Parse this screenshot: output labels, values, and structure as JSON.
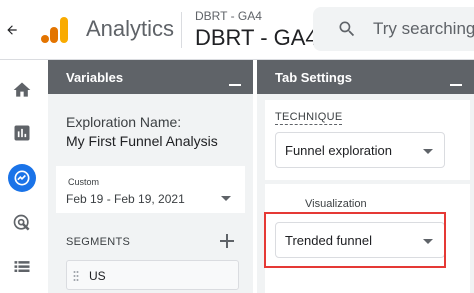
{
  "header": {
    "app_name": "Analytics",
    "account_path": "DBRT - GA4",
    "property_name": "DBRT - GA4",
    "search_placeholder": "Try searching"
  },
  "nav_rail": {
    "items": [
      "home-icon",
      "reports-icon",
      "explore-icon",
      "advertising-icon",
      "configure-icon"
    ],
    "active": "explore-icon",
    "accent_color": "#1a73e8"
  },
  "variables_panel": {
    "title": "Variables",
    "exploration_name_label": "Exploration Name:",
    "exploration_name_value": "My First Funnel Analysis",
    "date_range_tag": "Custom",
    "date_range_value": "Feb 19 - Feb 19, 2021",
    "segments_label": "SEGMENTS",
    "segment_items": [
      "US"
    ]
  },
  "tab_settings_panel": {
    "title": "Tab Settings",
    "technique_label": "TECHNIQUE",
    "technique_value": "Funnel exploration",
    "visualization_label": "Visualization",
    "visualization_value": "Trended funnel"
  },
  "colors": {
    "panel_header": "#5f6368",
    "panel_bg": "#f1f3f4",
    "highlight_border": "#e53935",
    "logo_orange": "#f9ab00",
    "logo_dark_orange": "#e37400"
  }
}
